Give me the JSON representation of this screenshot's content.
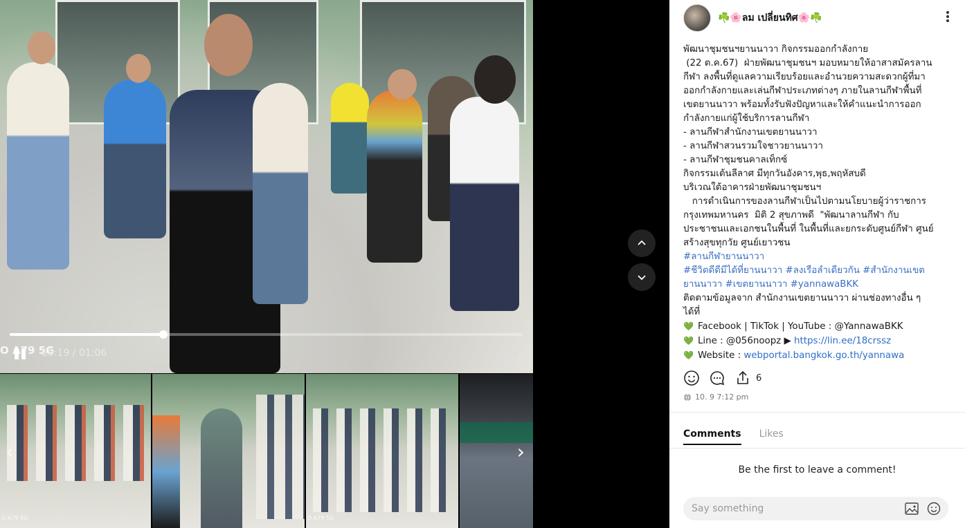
{
  "video": {
    "watermark": "O A79 5G",
    "time": "00:19 / 01:06",
    "progress": 0.3
  },
  "thumbs": [
    {
      "watermark": "O A79 5G"
    },
    {
      "watermark": ""
    },
    {
      "watermark": "O A79 5G"
    },
    {
      "watermark": ""
    }
  ],
  "post": {
    "username": "☘️🌸ลม เปลี่ยนทิศ🌸☘️",
    "lines": [
      "พัฒนาชุมชนฯยานนาวา กิจกรรมออกกำลังกาย",
      " (22 ต.ค.67)  ฝ่ายพัฒนาชุมชนฯ มอบหมายให้อาสาสมัครลาน",
      "กีฬา ลงพื้นที่ดูแลความเรียบร้อยและอำนวยความสะดวกผู้ที่มา",
      "ออกกำลังกายและเล่นกีฬาประเภทต่างๆ ภายในลานกีฬาพื้นที่",
      "เขตยานนาวา พร้อมทั้งรับฟังปัญหาและให้คำแนะนำการออก",
      "กำลังกายแก่ผู้ใช้บริการลานกีฬา",
      "- ลานกีฬาสำนักงานเขตยานนาวา",
      "- ลานกีฬาสวนรวมใจชาวยานนาวา",
      "- ลานกีฬาชุมชนคาลเท็กซ์",
      "กิจกรรมเต้นลีลาศ มีทุกวันอังคาร,พุธ,พฤหัสบดี",
      "บริเวณใต้อาคารฝ่ายพัฒนาชุมชนฯ",
      "   การดำเนินการของลานกีฬาเป็นไปตามนโยบายผู้ว่าราชการ",
      "กรุงเทพมหานคร  มิติ 2 สุขภาพดี  \"พัฒนาลานกีฬา กับ",
      "ประชาชนและเอกชนในพื้นที่ ในพื้นที่และยกระดับศูนย์กีฬา ศูนย์",
      "สร้างสุขทุกวัย ศูนย์เยาวชน"
    ],
    "tag1": "#ลานกีฬายานนาวา",
    "tags2": "#ชีวิตดีดีมีได้ที่ยานนาวา #ลงเรือลำเดียวกัน #สำนักงานเขต",
    "tags3": "ยานนาวา #เขตยานนาวา #yannawaBKK",
    "follow1": "ติดตามข้อมูลจาก สำนักงานเขตยานนาวา ผ่านช่องทางอื่น ๆ",
    "follow2": "ได้ที่",
    "heart": "💚",
    "social": "Facebook | TikTok | YouTube : @YannawaBKK",
    "line_label": "Line : @056noopz ▶ ",
    "line_url": "https://lin.ee/18crssz",
    "web_label": "Website : ",
    "web_url": "webportal.bangkok.go.th/yannawa",
    "share_count": "6",
    "timestamp": "10. 9 7:12 pm"
  },
  "comments": {
    "tab_comments": "Comments",
    "tab_likes": "Likes",
    "empty": "Be the first to leave a comment!",
    "placeholder": "Say something"
  }
}
